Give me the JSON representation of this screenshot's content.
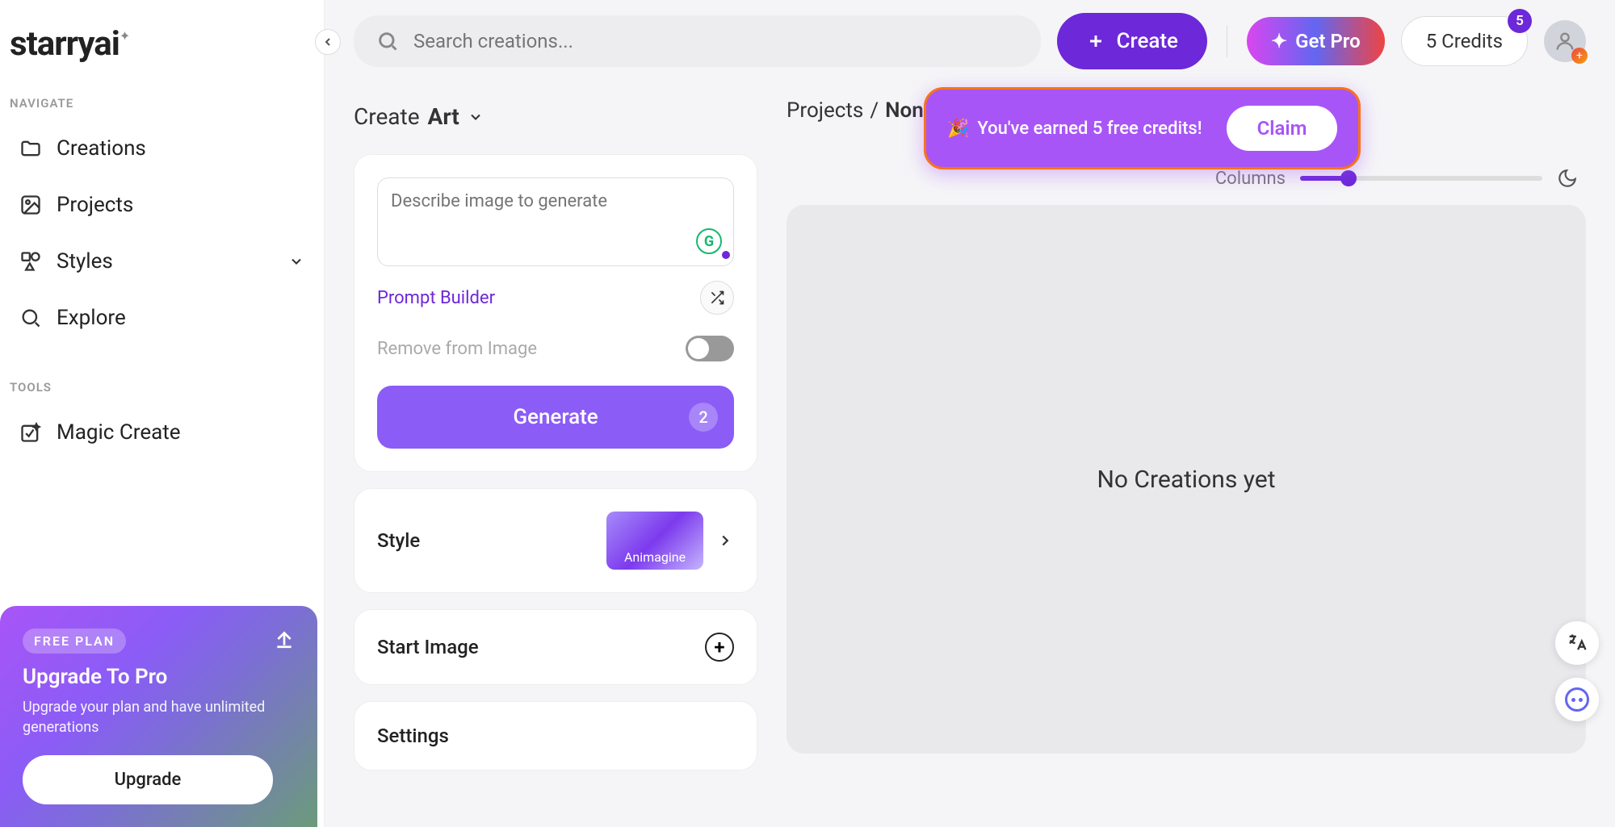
{
  "brand": "starryai",
  "sidebar": {
    "section_navigate": "NAVIGATE",
    "section_tools": "TOOLS",
    "items": {
      "creations": "Creations",
      "projects": "Projects",
      "styles": "Styles",
      "explore": "Explore",
      "magic_create": "Magic Create"
    }
  },
  "header": {
    "search_placeholder": "Search creations...",
    "create_label": "Create",
    "get_pro_label": "Get Pro",
    "credits_label": "5 Credits",
    "credits_badge": "5"
  },
  "create_panel": {
    "heading_prefix": "Create",
    "heading_bold": "Art",
    "prompt_placeholder": "Describe image to generate",
    "prompt_builder": "Prompt Builder",
    "remove_label": "Remove from Image",
    "generate_label": "Generate",
    "generate_count": "2",
    "style_label": "Style",
    "style_value": "Animagine",
    "start_image_label": "Start Image",
    "settings_label": "Settings"
  },
  "right": {
    "breadcrumb_root": "Projects",
    "breadcrumb_sep": "/",
    "breadcrumb_current": "None",
    "columns_label": "Columns",
    "empty_text": "No Creations yet"
  },
  "notification": {
    "emoji": "🎉",
    "text": "You've earned 5 free credits!",
    "claim": "Claim"
  },
  "upgrade": {
    "badge": "FREE PLAN",
    "title": "Upgrade To Pro",
    "desc": "Upgrade your plan and have unlimited generations",
    "button": "Upgrade"
  }
}
